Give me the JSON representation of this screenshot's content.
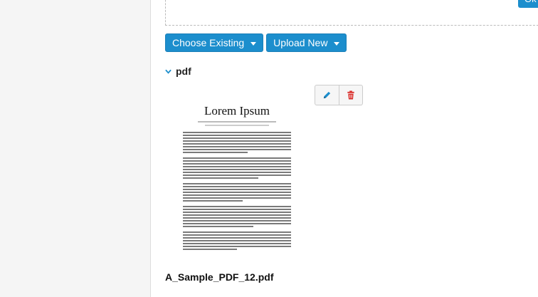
{
  "buttons": {
    "choose_existing": "Choose Existing",
    "upload_new": "Upload New"
  },
  "section": {
    "title": "pdf"
  },
  "file": {
    "thumbnail_title": "Lorem Ipsum",
    "name": "A_Sample_PDF_12.pdf"
  },
  "icons": {
    "edit": "pencil-icon",
    "delete": "trash-icon",
    "toggle": "chevron-down-icon"
  },
  "colors": {
    "primary": "#1c8ecd",
    "edit_icon": "#1c8ecd",
    "delete_icon": "#d9302c",
    "sidebar_bg": "#f5f5f5"
  }
}
